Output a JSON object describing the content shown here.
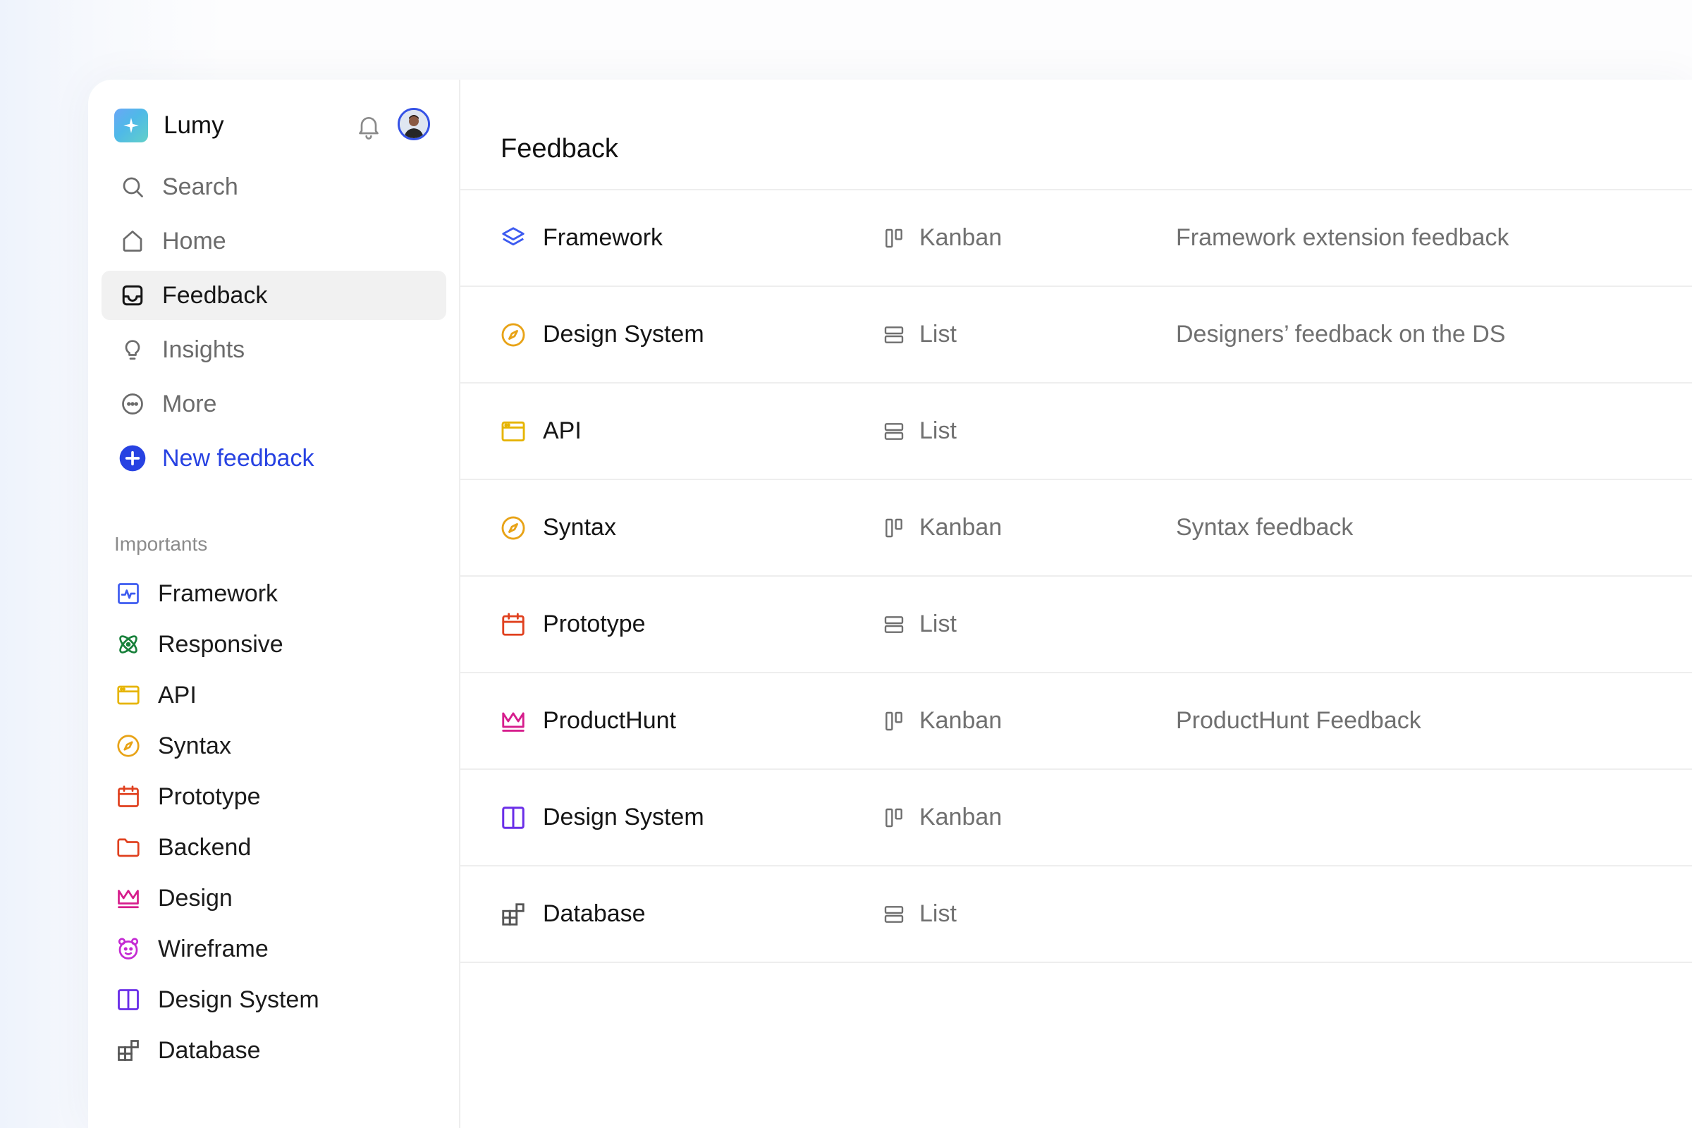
{
  "brand": {
    "name": "Lumy",
    "color": "#4fb9e8"
  },
  "header_icons": [
    "bell-icon",
    "avatar"
  ],
  "nav": [
    {
      "label": "Search",
      "icon": "search-icon",
      "state": "normal"
    },
    {
      "label": "Home",
      "icon": "home-icon",
      "state": "normal"
    },
    {
      "label": "Feedback",
      "icon": "inbox-icon",
      "state": "active"
    },
    {
      "label": "Insights",
      "icon": "lightbulb-icon",
      "state": "normal"
    },
    {
      "label": "More",
      "icon": "more-icon",
      "state": "normal"
    },
    {
      "label": "New feedback",
      "icon": "plus-circle-icon",
      "state": "primary"
    }
  ],
  "importants": {
    "label": "Importants",
    "items": [
      {
        "label": "Framework",
        "icon": "activity-icon",
        "color": "#3d5bf0"
      },
      {
        "label": "Responsive",
        "icon": "atom-icon",
        "color": "#17803a"
      },
      {
        "label": "API",
        "icon": "browser-window-icon",
        "color": "#e6b400"
      },
      {
        "label": "Syntax",
        "icon": "compass-icon",
        "color": "#e8a317"
      },
      {
        "label": "Prototype",
        "icon": "calendar-icon",
        "color": "#e0401e"
      },
      {
        "label": "Backend",
        "icon": "folder-icon",
        "color": "#e0401e"
      },
      {
        "label": "Design",
        "icon": "crown-icon",
        "color": "#d61d8c"
      },
      {
        "label": "Wireframe",
        "icon": "face-icon",
        "color": "#c42ad3"
      },
      {
        "label": "Design System",
        "icon": "columns-icon",
        "color": "#6a2ee8"
      },
      {
        "label": "Database",
        "icon": "blocks-icon",
        "color": "#555555"
      }
    ]
  },
  "main": {
    "title": "Feedback",
    "rows": [
      {
        "name": "Framework",
        "icon": "layers-icon",
        "color": "#3d5bf0",
        "view": "Kanban",
        "view_icon": "kanban-icon",
        "description": "Framework extension feedback"
      },
      {
        "name": "Design System",
        "icon": "compass-icon",
        "color": "#e8a317",
        "view": "List",
        "view_icon": "list-icon",
        "description": "Designers’ feedback on the DS"
      },
      {
        "name": "API",
        "icon": "browser-window-icon",
        "color": "#e6b400",
        "view": "List",
        "view_icon": "list-icon",
        "description": ""
      },
      {
        "name": "Syntax",
        "icon": "compass-icon",
        "color": "#e8a317",
        "view": "Kanban",
        "view_icon": "kanban-icon",
        "description": "Syntax feedback"
      },
      {
        "name": "Prototype",
        "icon": "calendar-icon",
        "color": "#e0401e",
        "view": "List",
        "view_icon": "list-icon",
        "description": ""
      },
      {
        "name": "ProductHunt",
        "icon": "crown-icon",
        "color": "#d61d8c",
        "view": "Kanban",
        "view_icon": "kanban-icon",
        "description": "ProductHunt Feedback"
      },
      {
        "name": "Design System",
        "icon": "columns-icon",
        "color": "#6a2ee8",
        "view": "Kanban",
        "view_icon": "kanban-icon",
        "description": ""
      },
      {
        "name": "Database",
        "icon": "blocks-icon",
        "color": "#555555",
        "view": "List",
        "view_icon": "list-icon",
        "description": ""
      }
    ]
  }
}
